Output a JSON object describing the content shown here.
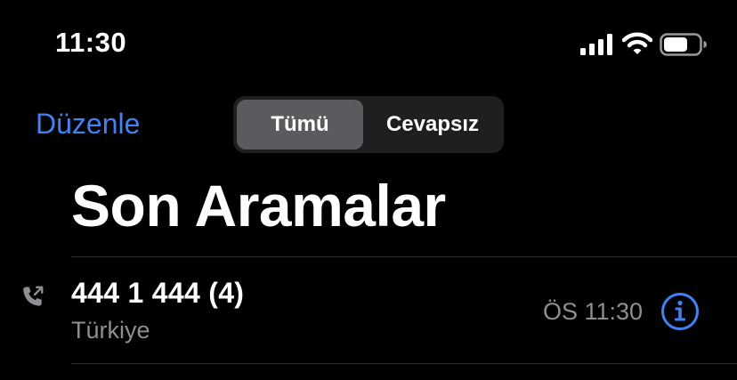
{
  "status_bar": {
    "time": "11:30",
    "icons": [
      "cellular-signal-icon",
      "wifi-icon",
      "battery-icon"
    ]
  },
  "header": {
    "edit_label": "Düzenle",
    "segments": [
      {
        "label": "Tümü",
        "selected": true
      },
      {
        "label": "Cevapsız",
        "selected": false
      }
    ],
    "title": "Son Aramalar"
  },
  "calls": [
    {
      "name": "444 1 444 (4)",
      "label": "Türkiye",
      "time": "ÖS 11:30",
      "type_icon": "outgoing-call-icon",
      "action_icon": "info-icon"
    }
  ],
  "colors": {
    "accent": "#3d82f6",
    "background": "#000000",
    "secondary_text": "#8e8e93",
    "segment_selected": "#5b5b5f",
    "segment_track": "#1f1f21"
  }
}
